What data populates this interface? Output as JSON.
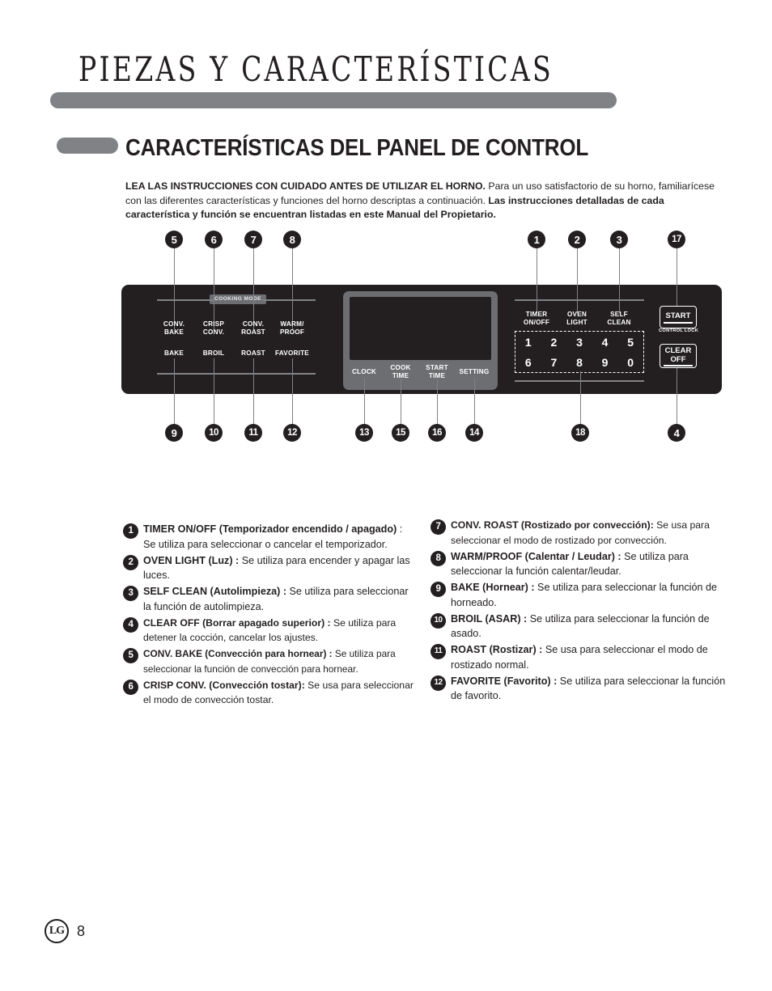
{
  "header": {
    "title": "PIEZAS Y CARACTERÍSTICAS",
    "section_title": "CARACTERÍSTICAS DEL PANEL DE CONTROL"
  },
  "intro": {
    "lead": "LEA LAS INSTRUCCIONES CON CUIDADO ANTES DE UTILIZAR EL HORNO.",
    "body": " Para un uso satisfactorio de su horno, familiarícese con las diferentes características y funciones del horno descriptas a continuación. ",
    "emphasis": "Las instrucciones detalladas de cada característica y función se encuentran listadas en este Manual del Propietario."
  },
  "panel": {
    "cooking_mode_badge": "COOKING MODE",
    "mode_buttons_row1": [
      {
        "label": "CONV.\nBAKE",
        "callout": "5"
      },
      {
        "label": "CRISP\nCONV.",
        "callout": "6"
      },
      {
        "label": "CONV.\nROAST",
        "callout": "7"
      },
      {
        "label": "WARM/\nPROOF",
        "callout": "8"
      }
    ],
    "mode_buttons_row2": [
      {
        "label": "BAKE",
        "callout": "9"
      },
      {
        "label": "BROIL",
        "callout": "10"
      },
      {
        "label": "ROAST",
        "callout": "11"
      },
      {
        "label": "FAVORITE",
        "callout": "12"
      }
    ],
    "display_buttons": [
      {
        "label": "CLOCK",
        "callout": "13"
      },
      {
        "label": "COOK\nTIME",
        "callout": "15"
      },
      {
        "label": "START\nTIME",
        "callout": "16"
      },
      {
        "label": "SETTING",
        "callout": "14"
      }
    ],
    "function_buttons": [
      {
        "label": "TIMER\nON/OFF",
        "callout": "1"
      },
      {
        "label": "OVEN\nLIGHT",
        "callout": "2"
      },
      {
        "label": "SELF\nCLEAN",
        "callout": "3"
      }
    ],
    "keypad": {
      "callout": "18",
      "row1": [
        "1",
        "2",
        "3",
        "4",
        "5"
      ],
      "row2": [
        "6",
        "7",
        "8",
        "9",
        "0"
      ]
    },
    "start_button": {
      "label": "START",
      "sublabel": "CONTROL LOCK",
      "callout": "17"
    },
    "clear_button": {
      "label_line1": "CLEAR",
      "label_line2": "OFF",
      "callout": "4"
    }
  },
  "legend_left": [
    {
      "num": "1",
      "bold": "TIMER ON/OFF (Temporizador encendido / apagado)",
      "rest": " : Se utiliza para seleccionar o cancelar el temporizador."
    },
    {
      "num": "2",
      "bold": "OVEN LIGHT (Luz) :",
      "rest": " Se utiliza para encender y apagar las luces."
    },
    {
      "num": "3",
      "bold": "SELF CLEAN (Autolimpieza) :",
      "rest": " Se utiliza para seleccionar la función de autolimpieza."
    },
    {
      "num": "4",
      "bold": "CLEAR OFF (Borrar apagado superior) :",
      "rest": " Se utiliza para detener la cocción, cancelar los ajustes."
    },
    {
      "num": "5",
      "bold": "CONV. BAKE (Convección para hornear) :",
      "rest": " Se utiliza para seleccionar la función de convección para hornear."
    },
    {
      "num": "6",
      "bold": "CRISP CONV. (Convección tostar):",
      "rest": " Se usa para seleccionar el modo de convección tostar."
    }
  ],
  "legend_right": [
    {
      "num": "7",
      "bold": "CONV. ROAST (Rostizado por convección):",
      "rest": " Se usa para seleccionar el modo de rostizado por convección."
    },
    {
      "num": "8",
      "bold": "WARM/PROOF (Calentar / Leudar) :",
      "rest": " Se utiliza para seleccionar la función calentar/leudar."
    },
    {
      "num": "9",
      "bold": "BAKE (Hornear) :",
      "rest": " Se utiliza para seleccionar la función de horneado."
    },
    {
      "num": "10",
      "bold": "BROIL (ASAR) :",
      "rest": " Se utiliza para seleccionar la función de asado."
    },
    {
      "num": "11",
      "bold": "ROAST (Rostizar) :",
      "rest": " Se usa para seleccionar el modo de rostizado normal."
    },
    {
      "num": "12",
      "bold": "FAVORITE (Favorito) :",
      "rest": " Se utiliza para seleccionar la función de favorito."
    }
  ],
  "footer": {
    "logo": "LG",
    "page_number": "8"
  }
}
